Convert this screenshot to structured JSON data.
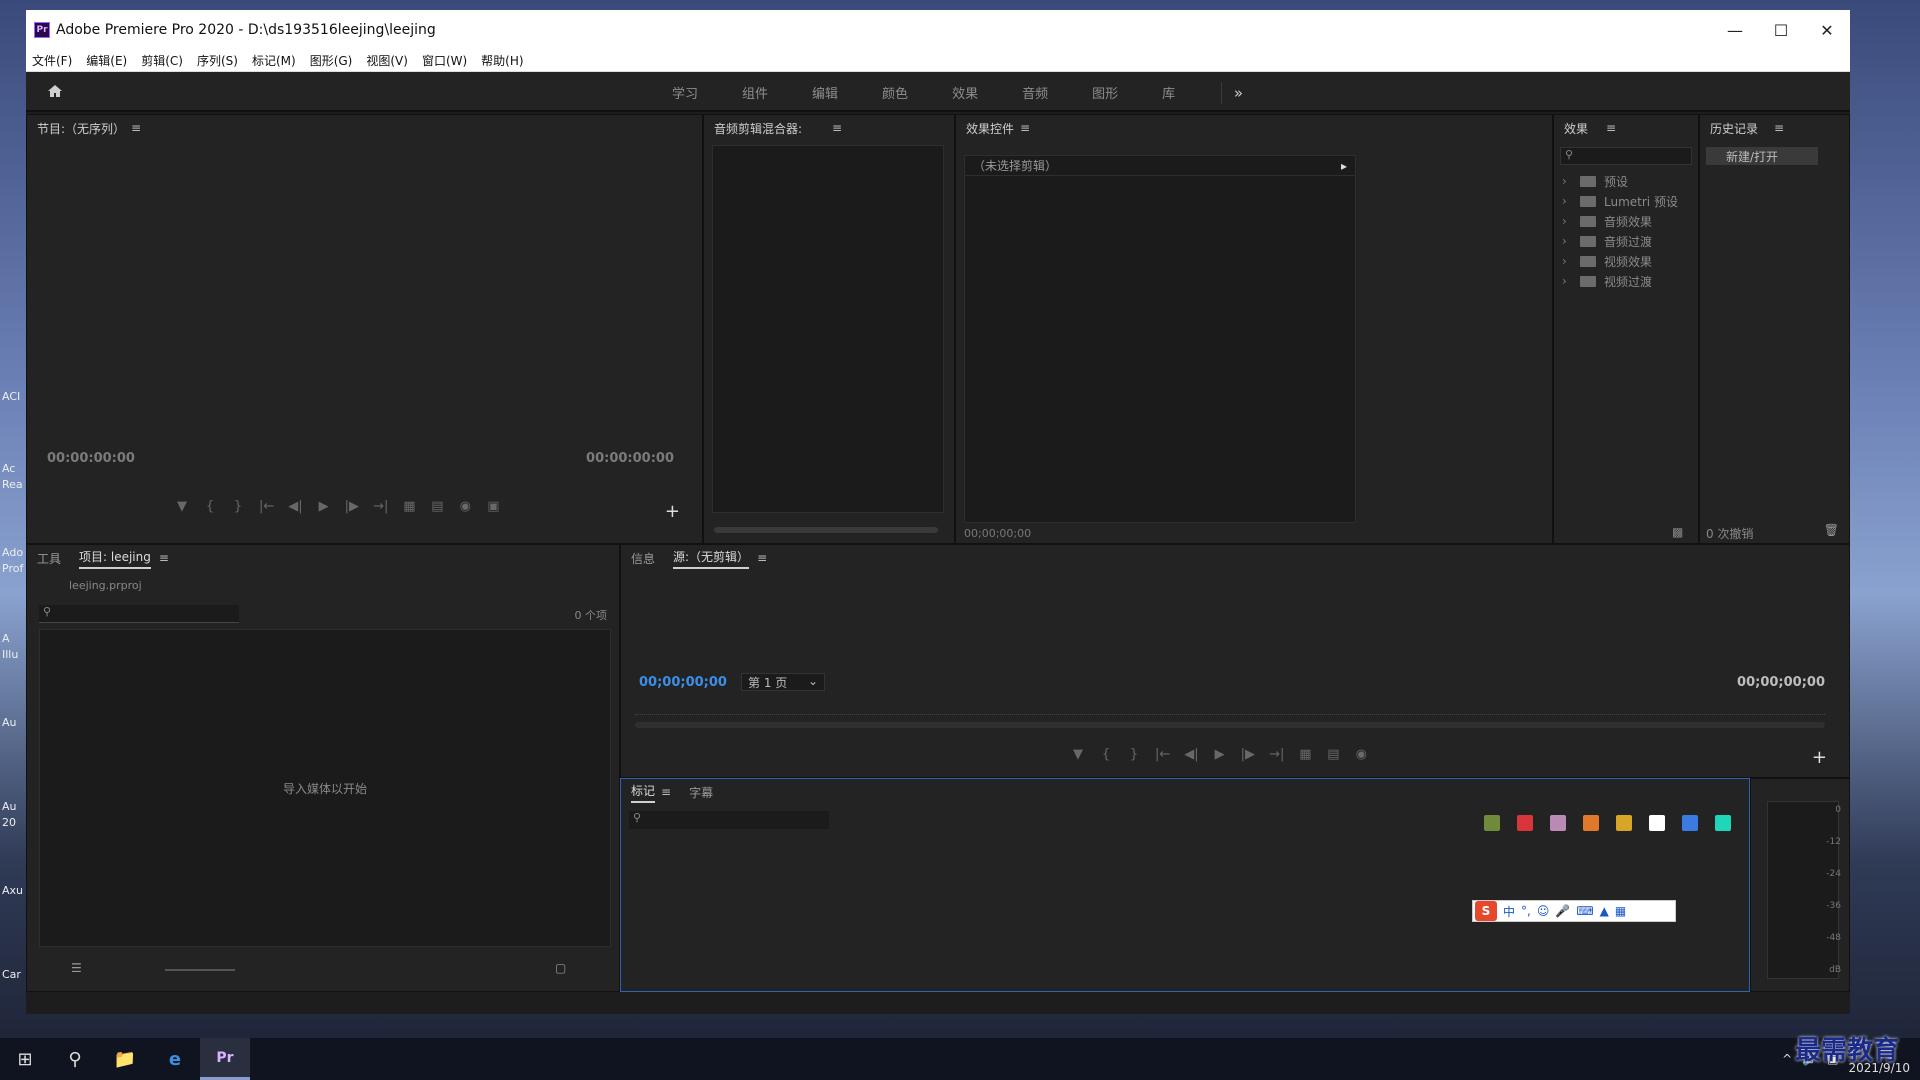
{
  "window": {
    "title": "Adobe Premiere Pro 2020 - D:\\ds193516leejing\\leejing",
    "logo": "Pr"
  },
  "menu": [
    "文件(F)",
    "编辑(E)",
    "剪辑(C)",
    "序列(S)",
    "标记(M)",
    "图形(G)",
    "视图(V)",
    "窗口(W)",
    "帮助(H)"
  ],
  "workspaces": [
    "学习",
    "组件",
    "编辑",
    "颜色",
    "效果",
    "音频",
    "图形",
    "库"
  ],
  "program": {
    "title": "节目:（无序列）",
    "tc_left": "00:00:00:00",
    "tc_right": "00:00:00:00"
  },
  "mixer": {
    "title": "音频剪辑混合器:"
  },
  "effect_controls": {
    "title": "效果控件",
    "no_clip": "（未选择剪辑）",
    "timecode": "00;00;00;00"
  },
  "effects": {
    "title": "效果",
    "items": [
      "预设",
      "Lumetri 预设",
      "音频效果",
      "音频过渡",
      "视频效果",
      "视频过渡"
    ]
  },
  "history": {
    "title": "历史记录",
    "entry": "新建/打开",
    "undo_count": "0 次撤销"
  },
  "project": {
    "tab_tools": "工具",
    "tab_project": "项目: leejing",
    "file": "leejing.prproj",
    "count": "0 个项",
    "empty_hint": "导入媒体以开始"
  },
  "source": {
    "tab_info": "信息",
    "tab_source": "源:（无剪辑）",
    "tc_left": "00;00;00;00",
    "page": "第 1 页",
    "tc_right": "00;00;00;00"
  },
  "markers": {
    "tab_markers": "标记",
    "tab_captions": "字幕",
    "colors": [
      "#6f8a3a",
      "#d8363a",
      "#b98bb4",
      "#e07a2a",
      "#d7a527",
      "#ffffff",
      "#3b7ae0",
      "#1fd6b8"
    ]
  },
  "meter": {
    "labels": [
      "0",
      "-12",
      "-24",
      "-36",
      "-48",
      "dB"
    ]
  },
  "ime": {
    "label": "中"
  },
  "taskbar": {
    "date": "2021/9/10"
  },
  "watermark": "最需教育",
  "desktop_labels": [
    "ACI",
    "Ac",
    "Rea",
    "Ado",
    "Prof",
    "A",
    "Illu",
    "Au",
    "Au",
    "20",
    "Axu",
    "Car"
  ]
}
